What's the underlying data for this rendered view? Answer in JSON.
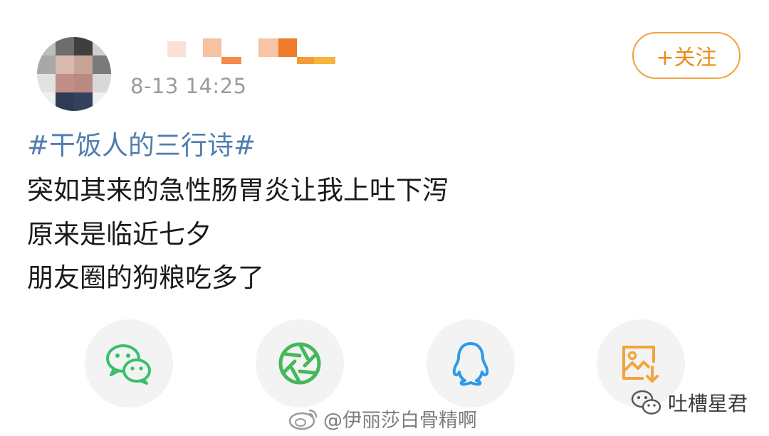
{
  "post": {
    "timestamp": "8-13 14:25",
    "follow_label": "+关注",
    "topic": "#干饭人的三行诗#",
    "lines": [
      "突如其来的急性肠胃炎让我上吐下泻",
      "原来是临近七夕",
      "朋友圈的狗粮吃多了"
    ]
  },
  "share": [
    {
      "name": "wechat-icon",
      "color": "#3bbf6b"
    },
    {
      "name": "moments-icon",
      "color": "#45b85a"
    },
    {
      "name": "qq-icon",
      "color": "#2b9ae8"
    },
    {
      "name": "save-image-icon",
      "color": "#f3a43c"
    }
  ],
  "watermarks": {
    "weibo_handle": "@伊丽莎白骨精啊",
    "account_name": "吐槽星君"
  },
  "colors": {
    "accent": "#ee8a18",
    "topic": "#507daf",
    "timestamp": "#9b9b9b"
  }
}
